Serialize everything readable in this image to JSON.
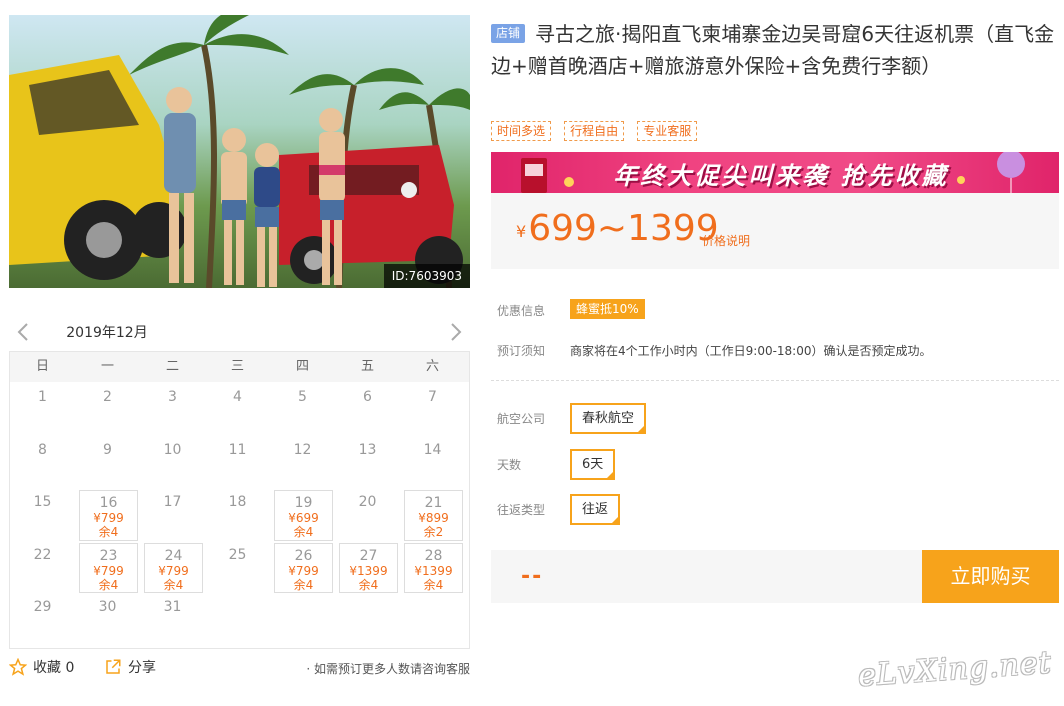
{
  "photo": {
    "id_label": "ID:7603903"
  },
  "calendar": {
    "month_label": "2019年12月",
    "prev_icon": "chevron-left-icon",
    "next_icon": "chevron-right-icon",
    "weekdays": [
      "日",
      "一",
      "二",
      "三",
      "四",
      "五",
      "六"
    ],
    "days": [
      {
        "d": "1"
      },
      {
        "d": "2"
      },
      {
        "d": "3"
      },
      {
        "d": "4"
      },
      {
        "d": "5"
      },
      {
        "d": "6"
      },
      {
        "d": "7"
      },
      {
        "d": "8"
      },
      {
        "d": "9"
      },
      {
        "d": "10"
      },
      {
        "d": "11"
      },
      {
        "d": "12"
      },
      {
        "d": "13"
      },
      {
        "d": "14"
      },
      {
        "d": "15"
      },
      {
        "d": "16",
        "price": "¥799",
        "remain": "余4"
      },
      {
        "d": "17"
      },
      {
        "d": "18"
      },
      {
        "d": "19",
        "price": "¥699",
        "remain": "余4"
      },
      {
        "d": "20"
      },
      {
        "d": "21",
        "price": "¥899",
        "remain": "余2"
      },
      {
        "d": "22"
      },
      {
        "d": "23",
        "price": "¥799",
        "remain": "余4"
      },
      {
        "d": "24",
        "price": "¥799",
        "remain": "余4"
      },
      {
        "d": "25"
      },
      {
        "d": "26",
        "price": "¥799",
        "remain": "余4"
      },
      {
        "d": "27",
        "price": "¥1399",
        "remain": "余4"
      },
      {
        "d": "28",
        "price": "¥1399",
        "remain": "余4"
      },
      {
        "d": "29"
      },
      {
        "d": "30"
      },
      {
        "d": "31"
      }
    ]
  },
  "social": {
    "collect_label": "收藏",
    "collect_count": "0",
    "share_label": "分享",
    "consult_text": "· 如需预订更多人数请咨询客服"
  },
  "product": {
    "shop_badge": "店铺",
    "title": "寻古之旅·揭阳直飞柬埔寨金边吴哥窟6天往返机票（直飞金边+赠首晚酒店+赠旅游意外保险+含免费行李额）",
    "tags": [
      "时间多选",
      "行程自由",
      "专业客服"
    ],
    "banner_text": "年终大促尖叫来袭  抢先收藏"
  },
  "price": {
    "currency": "¥",
    "range": "699~1399",
    "note": "价格说明"
  },
  "info": {
    "promo_label": "优惠信息",
    "promo_badge": "蜂蜜抵10%",
    "notice_label": "预订须知",
    "notice_text": "商家将在4个工作小时内（工作日9:00-18:00）确认是否预定成功。"
  },
  "options": {
    "airline_label": "航空公司",
    "airline_value": "春秋航空",
    "days_label": "天数",
    "days_value": "6天",
    "trip_label": "往返类型",
    "trip_value": "往返"
  },
  "buy": {
    "placeholder": "--",
    "button_label": "立即购买"
  },
  "watermark": "eLvXing.net",
  "colors": {
    "accent": "#f7a31b",
    "price": "#f06e1d",
    "banner": "#e0246a",
    "badge_blue": "#7aa3e6"
  }
}
